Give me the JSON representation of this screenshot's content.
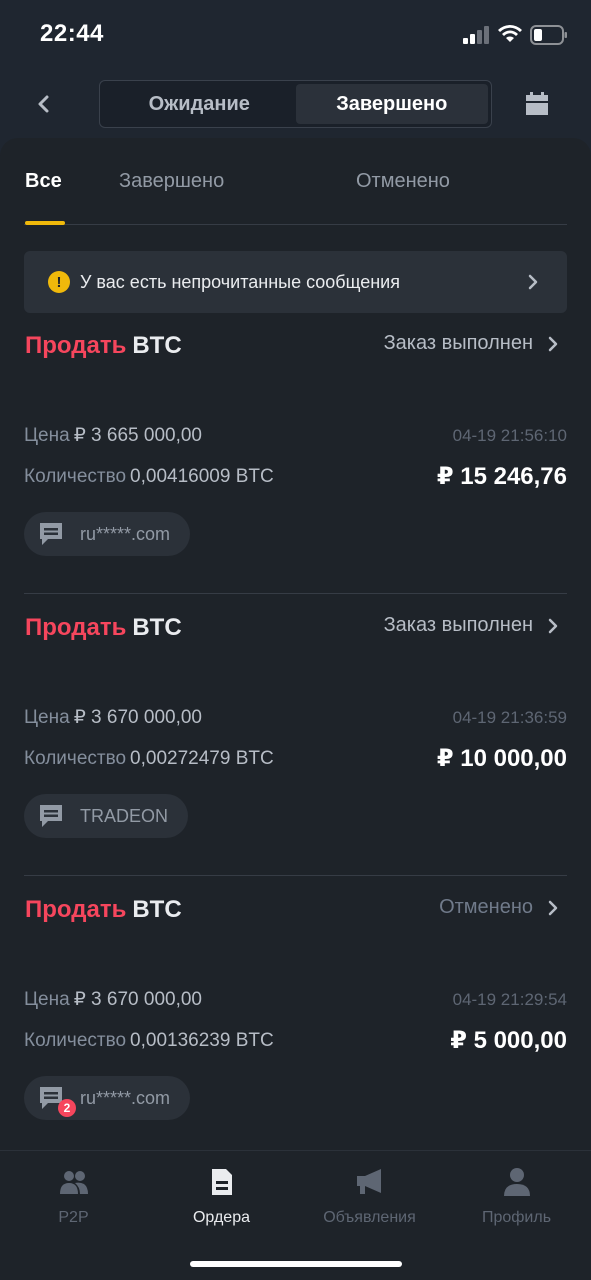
{
  "status_bar": {
    "time": "22:44"
  },
  "header": {
    "segments": [
      {
        "label": "Ожидание",
        "active": false
      },
      {
        "label": "Завершено",
        "active": true
      }
    ]
  },
  "tabs": [
    {
      "label": "Все",
      "active": true
    },
    {
      "label": "Завершено",
      "active": false
    },
    {
      "label": "Отменено",
      "active": false
    }
  ],
  "notice": {
    "icon": "!",
    "text": "У вас есть непрочитанные сообщения"
  },
  "labels": {
    "price": "Цена",
    "quantity": "Количество"
  },
  "orders": [
    {
      "side": "Продать",
      "asset": "BTC",
      "status": "Заказ выполнен",
      "price": "₽ 3 665 000,00",
      "datetime": "04-19 21:56:10",
      "quantity": "0,00416009 BTC",
      "total": "₽ 15 246,76",
      "counterparty": "ru*****.com",
      "unread": null
    },
    {
      "side": "Продать",
      "asset": "BTC",
      "status": "Заказ выполнен",
      "price": "₽ 3 670 000,00",
      "datetime": "04-19 21:36:59",
      "quantity": "0,00272479 BTC",
      "total": "₽ 10 000,00",
      "counterparty": "TRADEON",
      "unread": null
    },
    {
      "side": "Продать",
      "asset": "BTC",
      "status": "Отменено",
      "price": "₽ 3 670 000,00",
      "datetime": "04-19 21:29:54",
      "quantity": "0,00136239 BTC",
      "total": "₽ 5 000,00",
      "counterparty": "ru*****.com",
      "unread": "2"
    }
  ],
  "bottom_nav": [
    {
      "label": "P2P",
      "icon": "users-icon",
      "active": false
    },
    {
      "label": "Ордера",
      "icon": "document-icon",
      "active": true
    },
    {
      "label": "Объявления",
      "icon": "megaphone-icon",
      "active": false
    },
    {
      "label": "Профиль",
      "icon": "person-icon",
      "active": false
    }
  ],
  "colors": {
    "sell": "#f6465d",
    "accent": "#f0b90b",
    "background": "#1e2329"
  }
}
